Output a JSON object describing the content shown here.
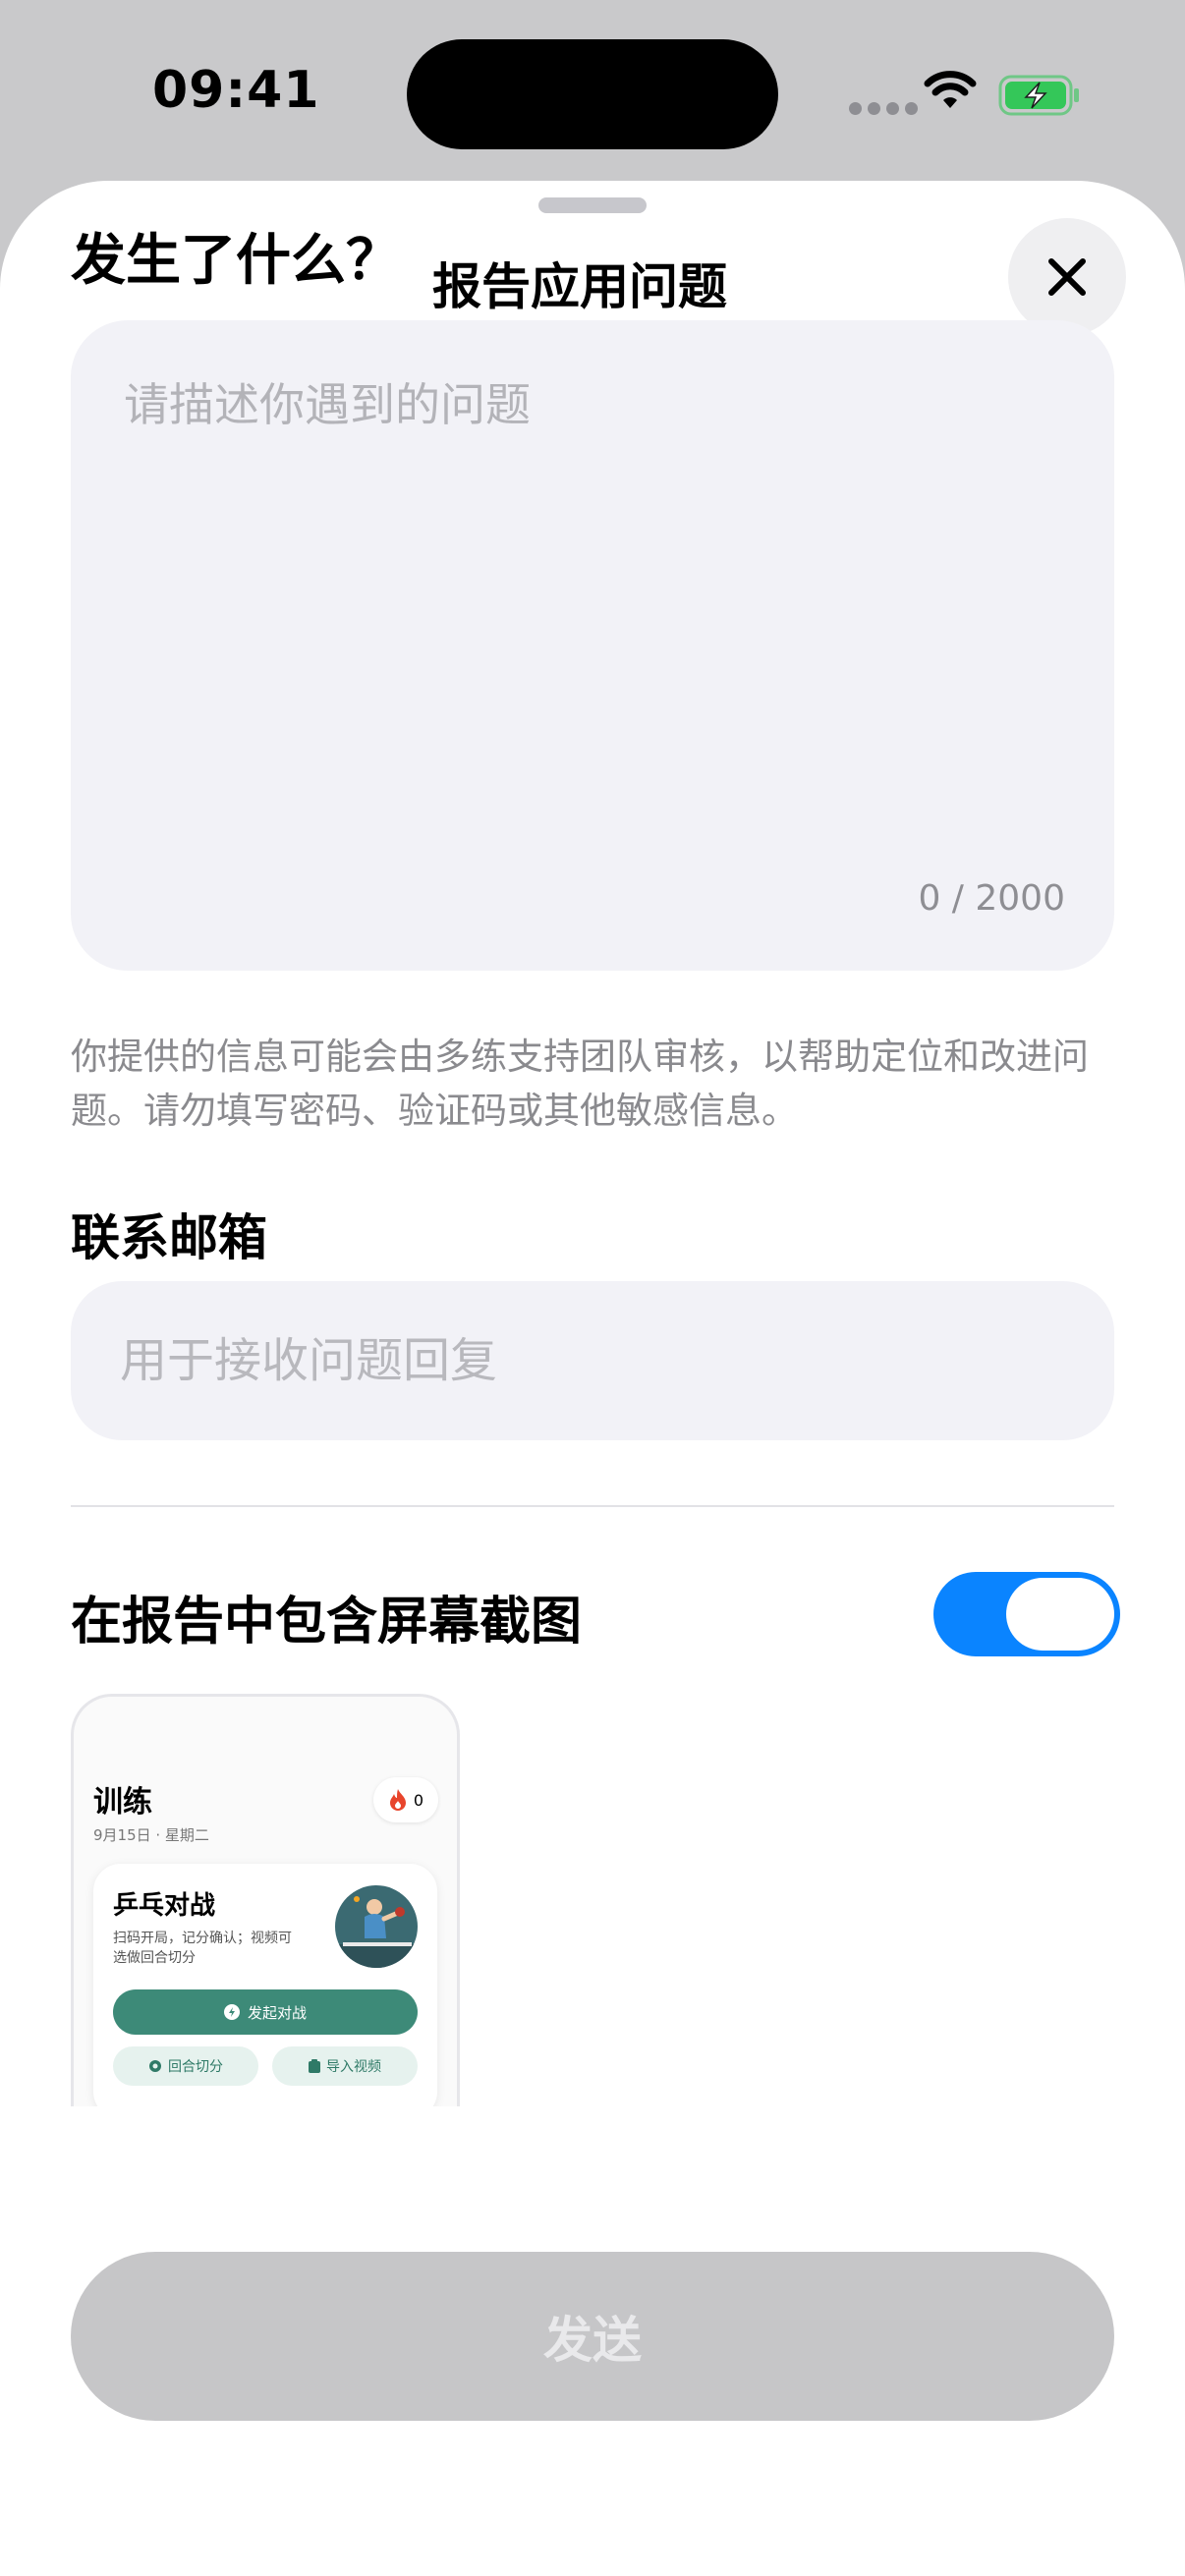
{
  "status_bar": {
    "time": "09:41"
  },
  "sheet": {
    "title": "报告应用问题",
    "question_title": "发生了什么？",
    "description": {
      "value": "",
      "placeholder": "请描述你遇到的问题",
      "counter": "0 / 2000"
    },
    "notice": "你提供的信息可能会由多练支持团队审核，以帮助定位和改进问题。请勿填写密码、验证码或其他敏感信息。",
    "email": {
      "title": "联系邮箱",
      "value": "",
      "placeholder": "用于接收问题回复"
    },
    "screenshot": {
      "label": "在报告中包含屏幕截图",
      "enabled": true
    },
    "send_label": "发送"
  },
  "preview": {
    "title": "训练",
    "date": "9月15日 · 星期二",
    "streak": "0",
    "card_title": "乒乓对战",
    "card_desc": "扫码开局，记分确认；视频可选做回合切分",
    "primary_label": "发起对战",
    "secondary_1": "回合切分",
    "secondary_2": "导入视频"
  },
  "colors": {
    "accent": "#0a84ff",
    "sheet_bg": "#ffffff",
    "field_bg": "#f2f2f7",
    "preview_green": "#3d8a78",
    "send_disabled": "#c6c6c8"
  }
}
